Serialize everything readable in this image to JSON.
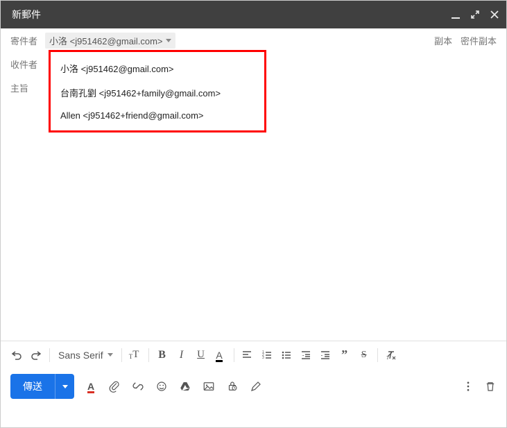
{
  "window": {
    "title": "新郵件"
  },
  "fields": {
    "from_label": "寄件者",
    "to_label": "收件者",
    "subject_label": "主旨",
    "cc": "副本",
    "bcc": "密件副本"
  },
  "from_selected": "小洛 <j951462@gmail.com>",
  "from_options": [
    "小洛 <j951462@gmail.com>",
    "台南孔劉 <j951462+family@gmail.com>",
    "Allen <j951462+friend@gmail.com>"
  ],
  "toolbar": {
    "font_family": "Sans Serif",
    "send_label": "傳送"
  }
}
